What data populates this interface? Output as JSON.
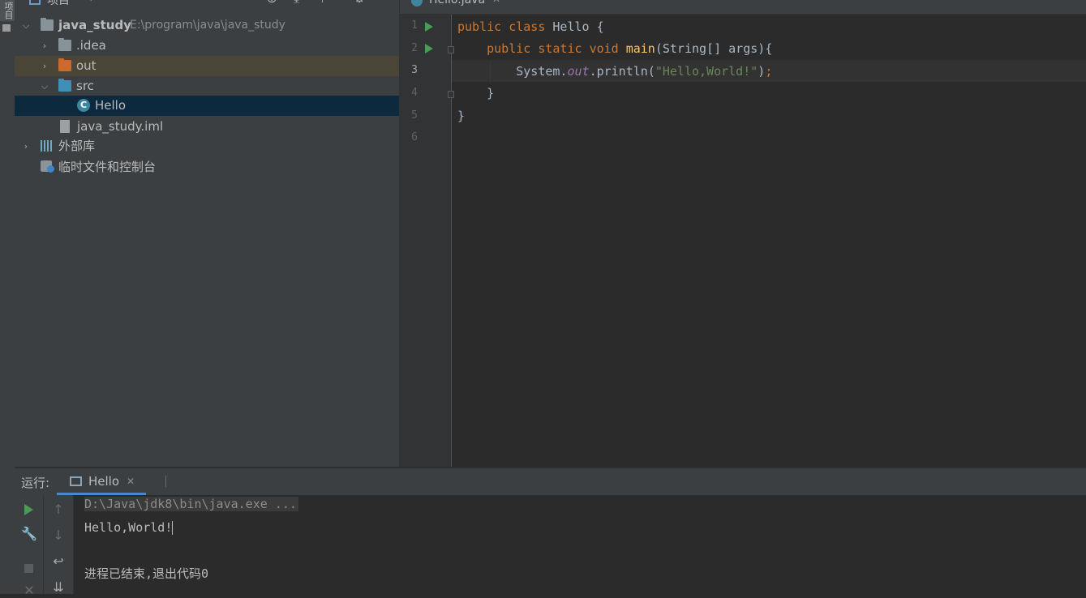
{
  "left_strip": {
    "tab_label": "项目"
  },
  "project_panel": {
    "header_label": "项目",
    "tree": [
      {
        "label": "java_study",
        "path": "E:\\program\\java\\java_study",
        "expanded": true
      },
      {
        "label": ".idea",
        "expanded": false
      },
      {
        "label": "out",
        "expanded": false
      },
      {
        "label": "src",
        "expanded": true
      },
      {
        "label": "Hello",
        "selected": true
      },
      {
        "label": "java_study.iml"
      },
      {
        "label": "外部库",
        "expanded": false
      },
      {
        "label": "临时文件和控制台"
      }
    ]
  },
  "editor": {
    "tab_label": "Hello.java",
    "line_numbers": [
      "1",
      "2",
      "3",
      "4",
      "5",
      "6"
    ],
    "current_line": "3",
    "code": {
      "l1_kw1": "public",
      "l1_kw2": "class",
      "l1_rest": " Hello {",
      "l2_kw1": "public",
      "l2_kw2": "static",
      "l2_kw3": "void",
      "l2_fn": "main",
      "l2_rest": "(String[] args){",
      "l3_a": "System.",
      "l3_field": "out",
      "l3_b": ".println(",
      "l3_str": "\"Hello,World!\"",
      "l3_c": ")",
      "l3_semi": ";",
      "l4": "}",
      "l5": "}"
    }
  },
  "run_panel": {
    "label": "运行:",
    "tab_label": "Hello",
    "console": {
      "command": "D:\\Java\\jdk8\\bin\\java.exe ...",
      "output": "Hello,World!",
      "exit": "进程已结束,退出代码0"
    }
  },
  "colors": {
    "keyword": "#cc7832",
    "function": "#ffc66d",
    "string": "#6a8759",
    "field": "#9876aa",
    "run_green": "#499c54",
    "selection": "#0d293e",
    "accent": "#4a88c7"
  }
}
